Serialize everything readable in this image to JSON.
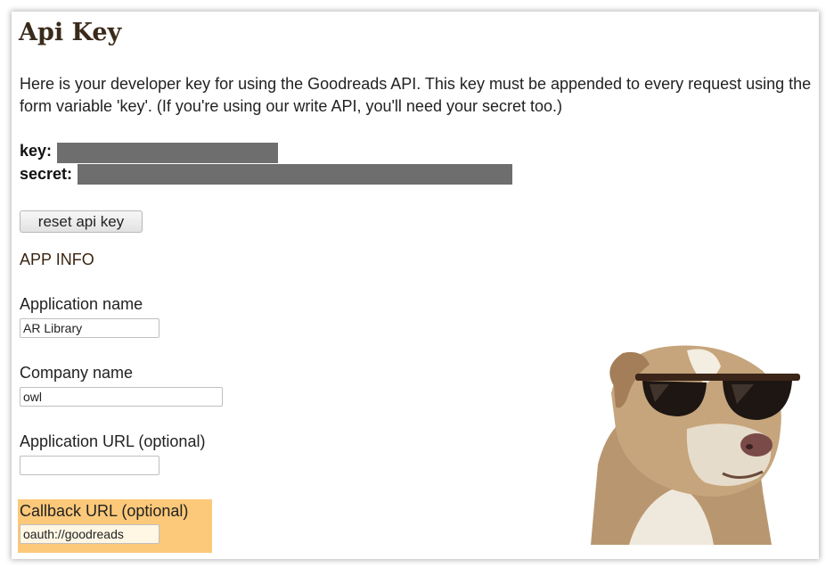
{
  "page": {
    "title": "Api Key",
    "intro": "Here is your developer key for using the Goodreads API. This key must be appended to every request using the form variable 'key'. (If you're using our write API, you'll need your secret too.)"
  },
  "credentials": {
    "key_label": "key:",
    "secret_label": "secret:"
  },
  "actions": {
    "reset_label": "reset api key"
  },
  "app_info": {
    "heading": "APP INFO",
    "application_name": {
      "label": "Application name",
      "value": "AR Library"
    },
    "company_name": {
      "label": "Company name",
      "value": "owl"
    },
    "application_url": {
      "label": "Application URL (optional)",
      "value": ""
    },
    "callback_url": {
      "label": "Callback URL (optional)",
      "value": "oauth://goodreads"
    }
  },
  "colors": {
    "highlight": "#fcc97a",
    "redaction": "#6e6e6e",
    "title": "#3a2a1a"
  }
}
